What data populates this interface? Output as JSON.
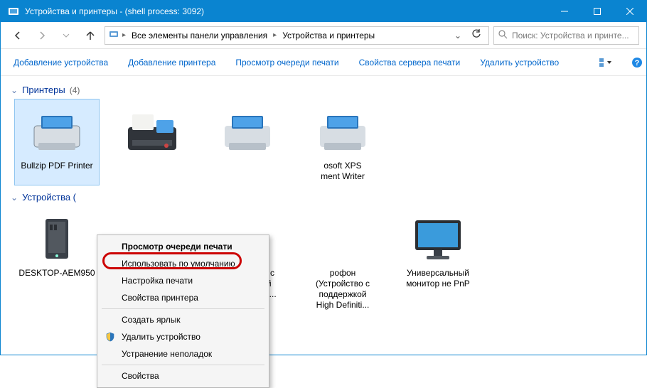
{
  "window": {
    "title": "Устройства и принтеры - (shell process: 3092)"
  },
  "breadcrumbs": {
    "root": "Все элементы панели управления",
    "current": "Устройства и принтеры"
  },
  "search": {
    "placeholder": "Поиск: Устройства и принте..."
  },
  "toolbar": {
    "add_device": "Добавление устройства",
    "add_printer": "Добавление принтера",
    "view_queue": "Просмотр очереди печати",
    "server_props": "Свойства сервера печати",
    "remove_device": "Удалить устройство"
  },
  "groups": {
    "printers": {
      "name": "Принтеры",
      "count": "(4)"
    },
    "devices": {
      "name": "Устройства ("
    }
  },
  "items": {
    "printer1": "Bullzip PDF Printer",
    "printer4_a": "osoft XPS",
    "printer4_b": "ment Writer",
    "device1": "DESKTOP-AEM950",
    "device3_a": "(Устройство с",
    "device3_b": "поддержкой",
    "device3_c": "High Definitio...",
    "device4_a": "рофон",
    "device4_b": "(Устройство с",
    "device4_c": "поддержкой",
    "device4_d": "High Definiti...",
    "device5_a": "Универсальный",
    "device5_b": "монитор не PnP"
  },
  "context_menu": {
    "view_queue": "Просмотр очереди печати",
    "set_default": "Использовать по умолчанию",
    "print_prefs": "Настройка печати",
    "printer_props": "Свойства принтера",
    "create_shortcut": "Создать ярлык",
    "remove": "Удалить устройство",
    "troubleshoot": "Устранение неполадок",
    "properties": "Свойства"
  }
}
